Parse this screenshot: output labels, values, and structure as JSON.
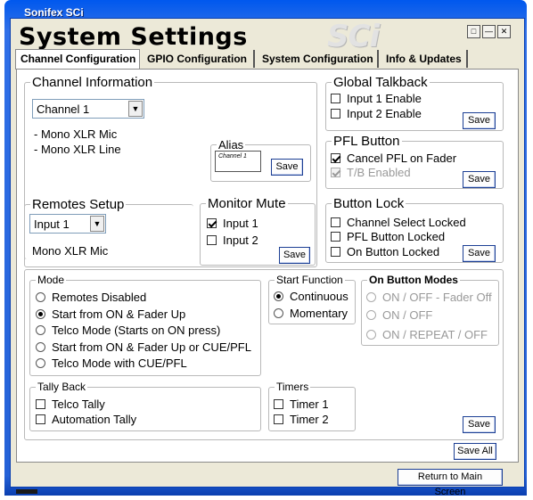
{
  "window": {
    "titlebar": "Sonifex SCi",
    "app_title": "System Settings",
    "logo": "SCi"
  },
  "tabs": [
    {
      "label": "Channel Configuration"
    },
    {
      "label": "GPIO Configuration"
    },
    {
      "label": "System Configuration"
    },
    {
      "label": "Info & Updates"
    }
  ],
  "channel_info": {
    "title": "Channel Information",
    "channel_select": "Channel 1",
    "line1": "- Mono XLR Mic",
    "line2": "- Mono XLR Line",
    "alias_title": "Alias",
    "alias_value": "Channel 1",
    "alias_save": "Save"
  },
  "global_talkback": {
    "title": "Global Talkback",
    "input1": "Input 1 Enable",
    "input2": "Input 2 Enable",
    "save": "Save"
  },
  "pfl_button": {
    "title": "PFL Button",
    "cancel_pfl": "Cancel PFL on Fader",
    "tb_enabled": "T/B Enabled",
    "save": "Save"
  },
  "remotes_setup": {
    "title": "Remotes Setup",
    "input_select": "Input 1",
    "description": "Mono XLR Mic"
  },
  "monitor_mute": {
    "title": "Monitor Mute",
    "input1": "Input 1",
    "input2": "Input 2",
    "save": "Save"
  },
  "button_lock": {
    "title": "Button Lock",
    "channel_select_locked": "Channel Select Locked",
    "pfl_button_locked": "PFL Button Locked",
    "on_button_locked": "On Button Locked",
    "save": "Save"
  },
  "mode": {
    "title": "Mode",
    "options": [
      "Remotes Disabled",
      "Start from ON & Fader Up",
      "Telco Mode (Starts on ON press)",
      "Start from ON & Fader Up or CUE/PFL",
      "Telco Mode with CUE/PFL"
    ],
    "selected_index": 1
  },
  "start_function": {
    "title": "Start Function",
    "continuous": "Continuous",
    "momentary": "Momentary"
  },
  "on_button_modes": {
    "title": "On Button Modes",
    "options": [
      "ON / OFF - Fader Off",
      "ON / OFF",
      "ON / REPEAT / OFF"
    ]
  },
  "tally_back": {
    "title": "Tally Back",
    "telco_tally": "Telco Tally",
    "automation_tally": "Automation Tally"
  },
  "timers": {
    "title": "Timers",
    "timer1": "Timer 1",
    "timer2": "Timer 2"
  },
  "actions": {
    "save": "Save",
    "save_all": "Save All",
    "return_main": "Return to Main Screen"
  }
}
